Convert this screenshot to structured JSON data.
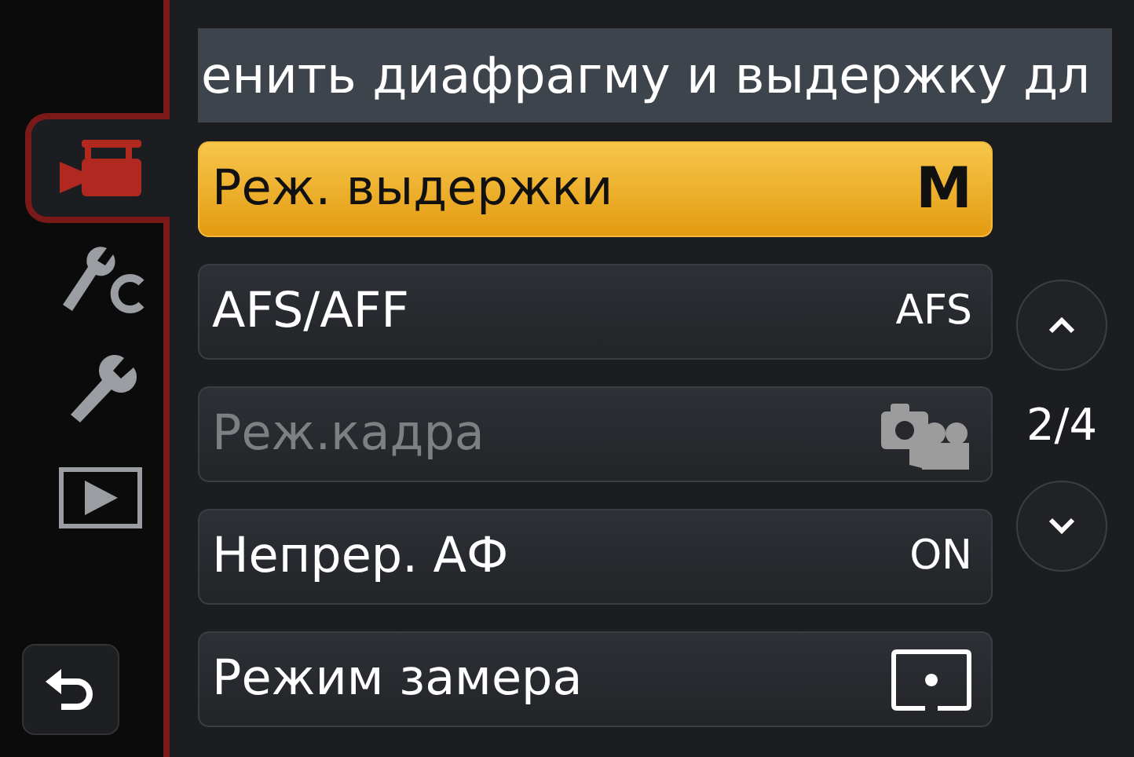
{
  "sidebar": {
    "tabs": [
      {
        "kind": "movie",
        "selected": true
      },
      {
        "kind": "custom",
        "selected": false
      },
      {
        "kind": "setup",
        "selected": false
      },
      {
        "kind": "playback",
        "selected": false
      }
    ]
  },
  "banner": {
    "text": "енить диафрагму и выдержку дл"
  },
  "menu": {
    "items": [
      {
        "label": "Реж. выдержки",
        "kind": "text",
        "value": "M",
        "selected": true,
        "disabled": false
      },
      {
        "label": "AFS/AFF",
        "kind": "text",
        "value": "AFS",
        "selected": false,
        "disabled": false
      },
      {
        "label": "Реж.кадра",
        "kind": "photo-movie",
        "selected": false,
        "disabled": true
      },
      {
        "label": "Непрер. АФ",
        "kind": "text",
        "value": "ON",
        "selected": false,
        "disabled": false
      },
      {
        "label": "Режим замера",
        "kind": "spot-metering",
        "selected": false,
        "disabled": false
      }
    ]
  },
  "pager": {
    "page": "2/4"
  }
}
